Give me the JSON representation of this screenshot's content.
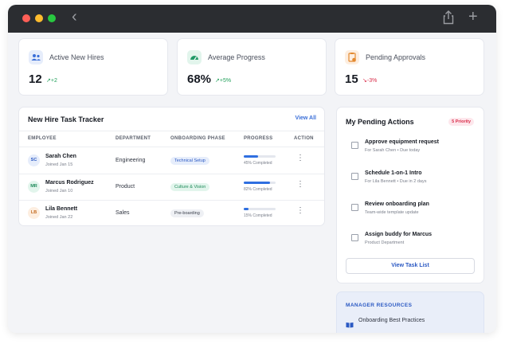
{
  "window": {
    "icons": {
      "back": "chevron-left-icon",
      "share": "share-icon",
      "new": "plus-icon"
    }
  },
  "stats": [
    {
      "label": "Active New Hires",
      "value": "12",
      "trend": "+2",
      "trend_direction": "up",
      "icon": "users-icon",
      "icon_color": "#3b6fd8",
      "icon_bg": "#e6edfb",
      "trend_color": "#22a05b"
    },
    {
      "label": "Average Progress",
      "value": "68%",
      "trend": "+5%",
      "trend_direction": "up",
      "icon": "gauge-icon",
      "icon_color": "#1f9a66",
      "icon_bg": "#e2f5ec",
      "trend_color": "#22a05b"
    },
    {
      "label": "Pending Approvals",
      "value": "15",
      "trend": "-3%",
      "trend_direction": "down",
      "icon": "clipboard-icon",
      "icon_color": "#e3892e",
      "icon_bg": "#fdeee0",
      "trend_color": "#d92d4a"
    }
  ],
  "tracker": {
    "title": "New Hire Task Tracker",
    "view_all": "View All",
    "columns": [
      "EMPLOYEE",
      "DEPARTMENT",
      "ONBOARDING PHASE",
      "PROGRESS",
      "ACTION"
    ],
    "rows": [
      {
        "initials": "SC",
        "name": "Sarah Chen",
        "joined": "Joined Jan 15",
        "department": "Engineering",
        "phase": "Technical Setup",
        "phase_bg": "#e6edfb",
        "phase_color": "#2b59c3",
        "progress": 45,
        "progress_label": "45% Completed",
        "avatar_bg": "#e6edfb",
        "avatar_color": "#2b59c3"
      },
      {
        "initials": "MR",
        "name": "Marcus Rodriguez",
        "joined": "Joined Jan 10",
        "department": "Product",
        "phase": "Culture & Vision",
        "phase_bg": "#e2f5ec",
        "phase_color": "#1f8a5a",
        "progress": 82,
        "progress_label": "82% Completed",
        "avatar_bg": "#e2f5ec",
        "avatar_color": "#1f8a5a"
      },
      {
        "initials": "LB",
        "name": "Lila Bennett",
        "joined": "Joined Jan 22",
        "department": "Sales",
        "phase": "Pre-boarding",
        "phase_bg": "#eef0f4",
        "phase_color": "#3a3f4b",
        "progress": 15,
        "progress_label": "15% Completed",
        "avatar_bg": "#fdeee0",
        "avatar_color": "#c26a1e"
      }
    ]
  },
  "pending": {
    "title": "My Pending Actions",
    "badge": "5 Priority",
    "tasks": [
      {
        "title": "Approve equipment request",
        "sub": "For Sarah Chen • Due today"
      },
      {
        "title": "Schedule 1-on-1 Intro",
        "sub": "For Lila Bennett • Due in 2 days"
      },
      {
        "title": "Review onboarding plan",
        "sub": "Team-wide template update"
      },
      {
        "title": "Assign buddy for Marcus",
        "sub": "Product Department"
      }
    ],
    "button": "View Task List"
  },
  "resources": {
    "title": "MANAGER RESOURCES",
    "items": [
      {
        "label": "Onboarding Best Practices",
        "icon": "book-icon"
      }
    ]
  }
}
